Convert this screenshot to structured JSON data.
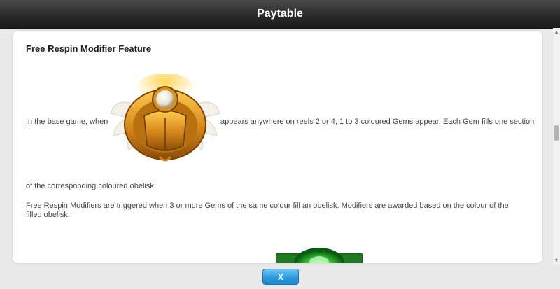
{
  "header": {
    "title": "Paytable"
  },
  "section": {
    "title": "Free Respin Modifier Feature",
    "para1_prefix": "In the base game, when",
    "para1_suffix": "appears anywhere on reels 2 or 4, 1 to 3 coloured Gems appear. Each Gem fills one section",
    "para1_continuation": "of the corresponding coloured obelisk.",
    "para2": "Free Respin Modifiers are triggered when 3 or more Gems of the same colour fill an obelisk. Modifiers are awarded based on the colour of the filled obelisk."
  },
  "symbols": {
    "scarab": "golden-scarab-icon",
    "gem": "green-gem-icon"
  },
  "footer": {
    "close_label": "X"
  },
  "colors": {
    "titlebar": "#2a2a2a",
    "panel": "#ffffff",
    "text": "#444444",
    "button": "#2a9be0",
    "gold": "#d89a1e",
    "gem_green": "#3cd63c"
  }
}
